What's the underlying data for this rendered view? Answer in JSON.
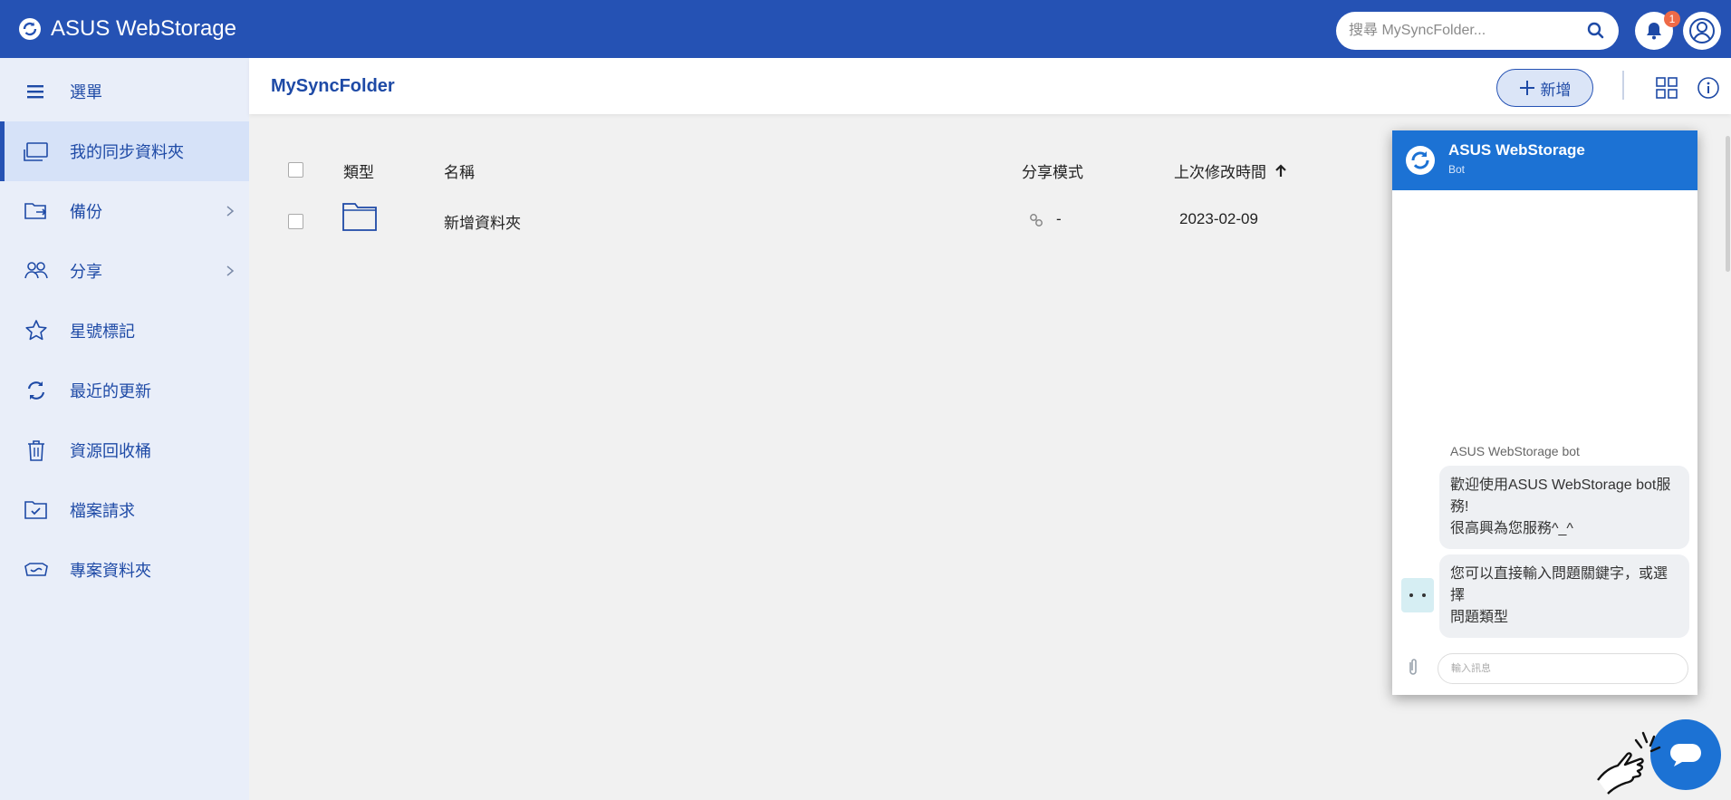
{
  "app": {
    "title": "ASUS WebStorage"
  },
  "header": {
    "search_placeholder": "搜尋 MySyncFolder...",
    "notification_count": "1"
  },
  "sidebar": {
    "items": [
      {
        "label": "選單",
        "icon": "menu-icon"
      },
      {
        "label": "我的同步資料夾",
        "icon": "sync-folder-icon",
        "active": true
      },
      {
        "label": "備份",
        "icon": "backup-icon",
        "has_submenu": true
      },
      {
        "label": "分享",
        "icon": "share-users-icon",
        "has_submenu": true
      },
      {
        "label": "星號標記",
        "icon": "star-icon"
      },
      {
        "label": "最近的更新",
        "icon": "refresh-icon"
      },
      {
        "label": "資源回收桶",
        "icon": "trash-icon"
      },
      {
        "label": "檔案請求",
        "icon": "file-request-icon"
      },
      {
        "label": "專案資料夾",
        "icon": "project-folder-icon"
      }
    ]
  },
  "main": {
    "folder_title": "MySyncFolder",
    "new_button_label": "新增",
    "table": {
      "columns": [
        "類型",
        "名稱",
        "分享模式",
        "上次修改時間"
      ],
      "rows": [
        {
          "type_icon": "folder-icon",
          "name": "新增資料夾",
          "share_mode": "-",
          "modified": "2023-02-09"
        }
      ]
    }
  },
  "chat": {
    "title": "ASUS WebStorage",
    "subtitle": "Bot",
    "bot_name": "ASUS WebStorage bot",
    "messages": [
      "歡迎使用ASUS WebStorage bot服\n務!\n很高興為您服務^_^",
      "您可以直接輸入問題關鍵字，或選擇\n問題類型"
    ],
    "input_placeholder": "輸入訊息"
  },
  "colors": {
    "topbar": "#2552b4",
    "sidebar_bg": "#e9eef9",
    "accent_text": "#1e4aa6",
    "chat_header": "#1c72d4",
    "badge": "#ee6a47"
  }
}
